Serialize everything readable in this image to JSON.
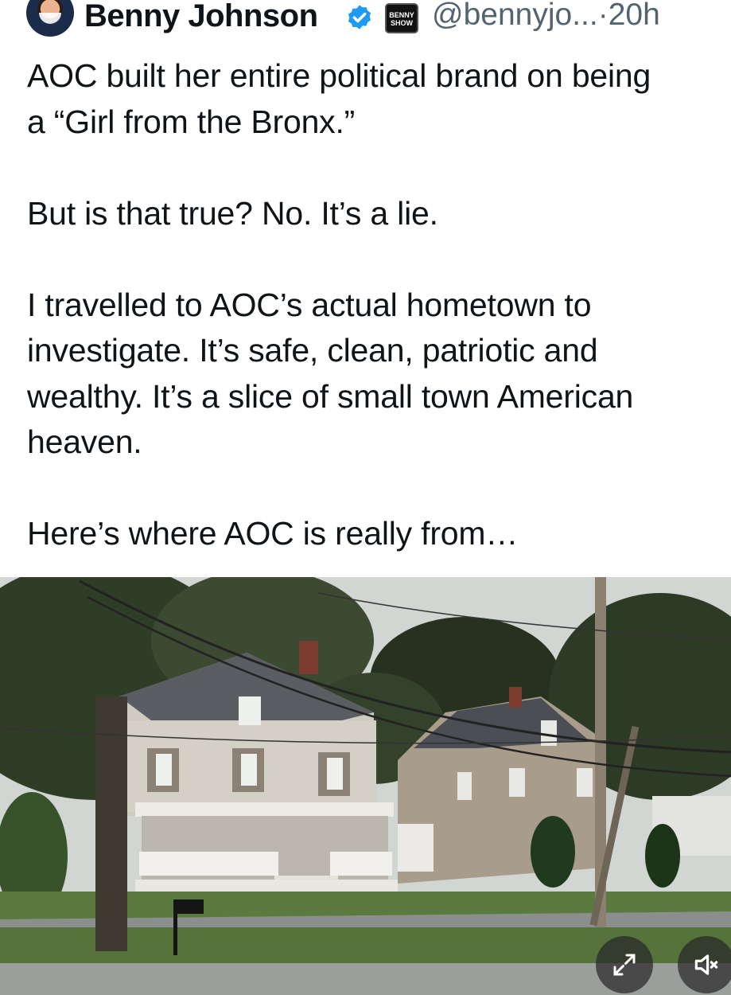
{
  "tweet": {
    "author": {
      "display_name": "Benny Johnson",
      "handle": "@bennyjo...",
      "affiliate_badge": "BENNY SHOW",
      "verified_color": "#1d9bf0"
    },
    "separator": "·",
    "timestamp": "20h",
    "body": "AOC built her entire political brand on being\na “Girl from the Bronx.”\n\nBut is that true? No. It’s a lie.\n\nI travelled to AOC’s actual hometown to\ninvestigate. It’s safe, clean, patriotic and\nwealthy. It’s a slice of small town American\nheaven.\n\nHere’s where AOC is really from…"
  },
  "media": {
    "icons": [
      "expand-icon",
      "mute-icon"
    ]
  }
}
